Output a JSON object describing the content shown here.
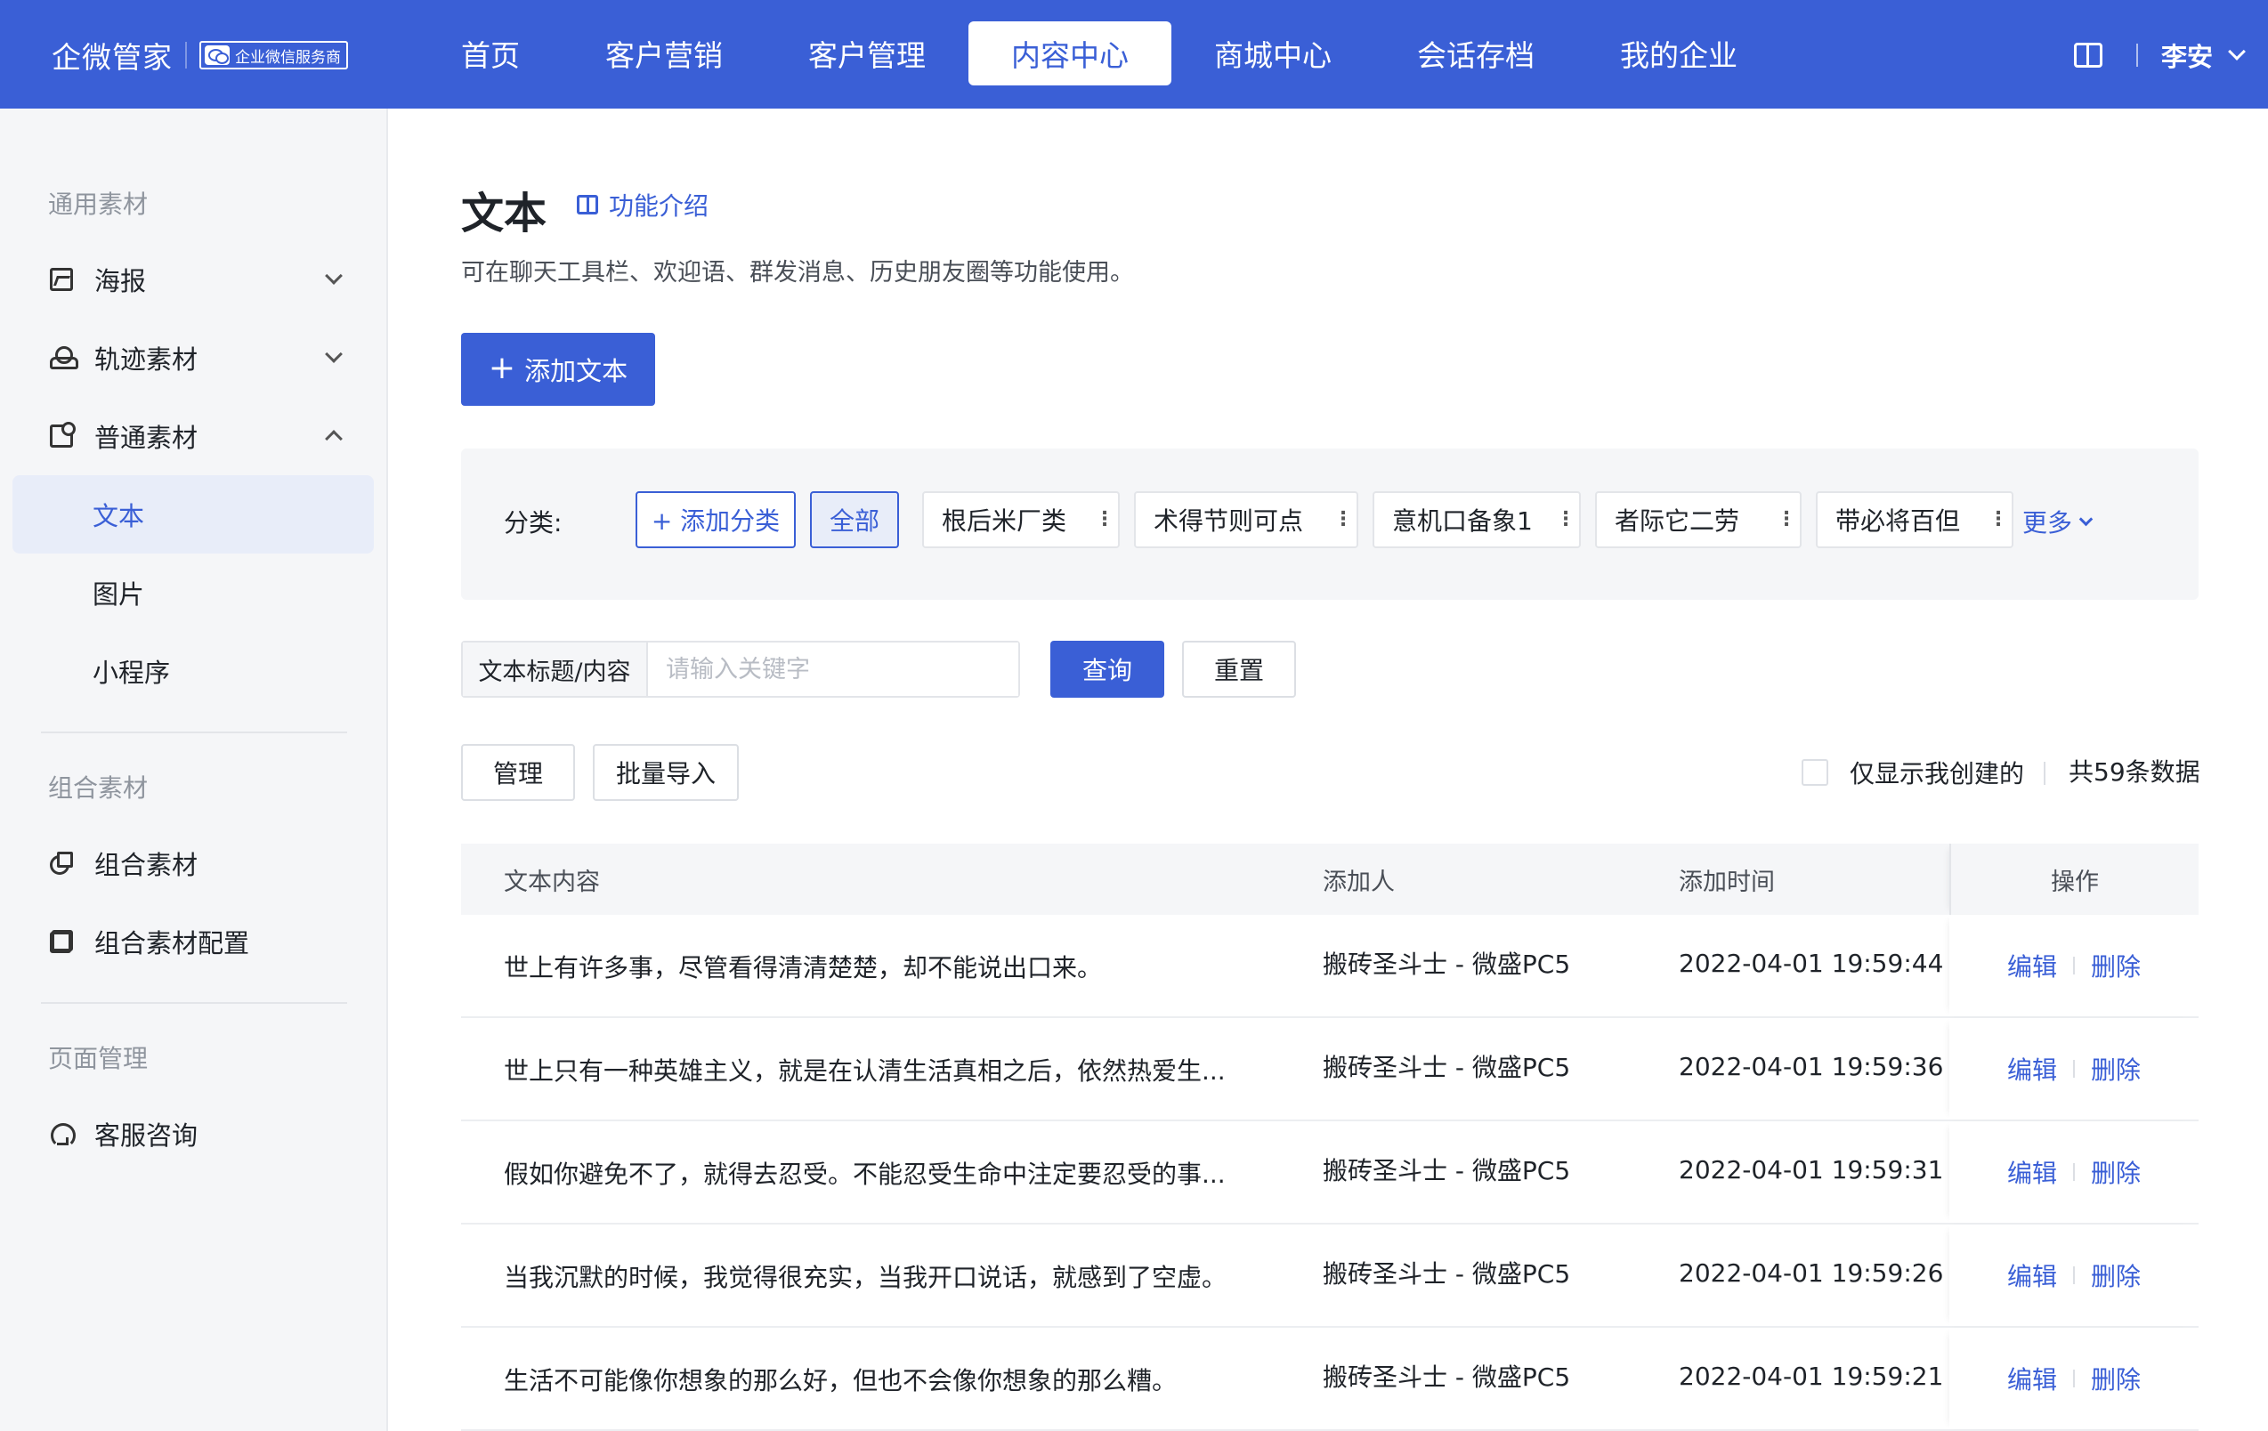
{
  "brand": {
    "name": "企微管家",
    "badge": "企业微信服务商"
  },
  "nav": {
    "items": [
      {
        "label": "首页"
      },
      {
        "label": "客户营销"
      },
      {
        "label": "客户管理"
      },
      {
        "label": "内容中心",
        "active": true
      },
      {
        "label": "商城中心"
      },
      {
        "label": "会话存档"
      },
      {
        "label": "我的企业"
      }
    ],
    "user": "李安"
  },
  "sidebar": {
    "group1_title": "通用素材",
    "poster": "海报",
    "track": "轨迹素材",
    "normal": "普通素材",
    "sub_text": "文本",
    "sub_image": "图片",
    "sub_miniapp": "小程序",
    "group2_title": "组合素材",
    "combo": "组合素材",
    "combo_config": "组合素材配置",
    "group3_title": "页面管理",
    "service": "客服咨询"
  },
  "main": {
    "title": "文本",
    "intro_link": "功能介绍",
    "description": "可在聊天工具栏、欢迎语、群发消息、历史朋友圈等功能使用。",
    "add_button": "添加文本",
    "category": {
      "label": "分类:",
      "add": "+ 添加分类",
      "all": "全部",
      "chips": [
        "根后米厂类",
        "术得节则可点",
        "意机口备象1",
        "者际它二劳",
        "带必将百但"
      ],
      "more": "更多"
    },
    "search": {
      "prefix": "文本标题/内容",
      "placeholder": "请输入关键字",
      "query": "查询",
      "reset": "重置"
    },
    "toolbar": {
      "manage": "管理",
      "import": "批量导入",
      "only_mine": "仅显示我创建的",
      "count": "共59条数据"
    },
    "table": {
      "headers": {
        "content": "文本内容",
        "adder": "添加人",
        "time": "添加时间",
        "op": "操作"
      },
      "edit": "编辑",
      "delete": "删除",
      "rows": [
        {
          "content": "世上有许多事，尽管看得清清楚楚，却不能说出口来。",
          "adder": "搬砖圣斗士 - 微盛PC5",
          "time": "2022-04-01 19:59:44"
        },
        {
          "content": "世上只有一种英雄主义，就是在认清生活真相之后，依然热爱生...",
          "adder": "搬砖圣斗士 - 微盛PC5",
          "time": "2022-04-01 19:59:36"
        },
        {
          "content": "假如你避免不了，就得去忍受。不能忍受生命中注定要忍受的事...",
          "adder": "搬砖圣斗士 - 微盛PC5",
          "time": "2022-04-01 19:59:31"
        },
        {
          "content": "当我沉默的时候，我觉得很充实，当我开口说话，就感到了空虚。",
          "adder": "搬砖圣斗士 - 微盛PC5",
          "time": "2022-04-01 19:59:26"
        },
        {
          "content": "生活不可能像你想象的那么好，但也不会像你想象的那么糟。",
          "adder": "搬砖圣斗士 - 微盛PC5",
          "time": "2022-04-01 19:59:21"
        }
      ]
    }
  },
  "colors": {
    "primary": "#3A5FD6",
    "sidebar_bg": "#F5F6F8",
    "active_bg": "#E8EDF9"
  }
}
